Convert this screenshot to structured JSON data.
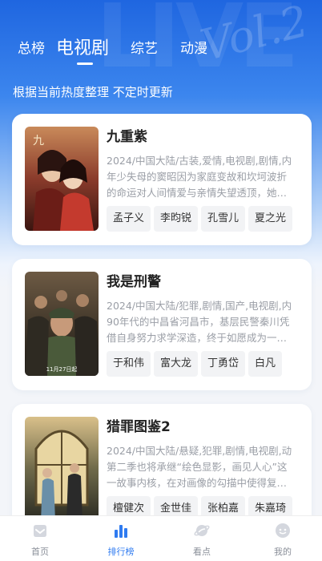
{
  "tabs": [
    {
      "label": "总榜",
      "active": false
    },
    {
      "label": "电视剧",
      "active": true
    },
    {
      "label": "综艺",
      "active": false
    },
    {
      "label": "动漫",
      "active": false
    }
  ],
  "subtitle": "根据当前热度整理 不定时更新",
  "accent_color": "#2f7bf0",
  "cards": [
    {
      "title": "九重紫",
      "meta": "2024/中国大陆/古装,爱情,电视剧,剧情,内",
      "desc": "年少失母的窦昭因为家庭变故和坎坷波折的命运对人间情爱与亲情失望透顶，她…",
      "actors": [
        "孟子义",
        "李昀锐",
        "孔雪儿",
        "夏之光"
      ]
    },
    {
      "title": "我是刑警",
      "meta": "2024/中国大陆/犯罪,剧情,国产,电视剧,内",
      "desc": "90年代的中昌省河昌市，基层民警秦川凭借自身努力求学深造，终于如愿成为一…",
      "actors": [
        "于和伟",
        "富大龙",
        "丁勇岱",
        "白凡"
      ],
      "poster_text": "11月27日起"
    },
    {
      "title": "猎罪图鉴2",
      "meta": "2024/中国大陆/悬疑,犯罪,剧情,电视剧,动",
      "desc": "第二季也将承继“绘色显影，画见人心”这一故事内核，在对画像的勾描中使得复…",
      "actors": [
        "檀健次",
        "金世佳",
        "张柏嘉",
        "朱嘉琦"
      ]
    }
  ],
  "bottom_nav": [
    {
      "label": "首页",
      "icon": "home-icon",
      "active": false
    },
    {
      "label": "排行榜",
      "icon": "ranking-icon",
      "active": true
    },
    {
      "label": "看点",
      "icon": "planet-icon",
      "active": false
    },
    {
      "label": "我的",
      "icon": "profile-face-icon",
      "active": false
    }
  ]
}
